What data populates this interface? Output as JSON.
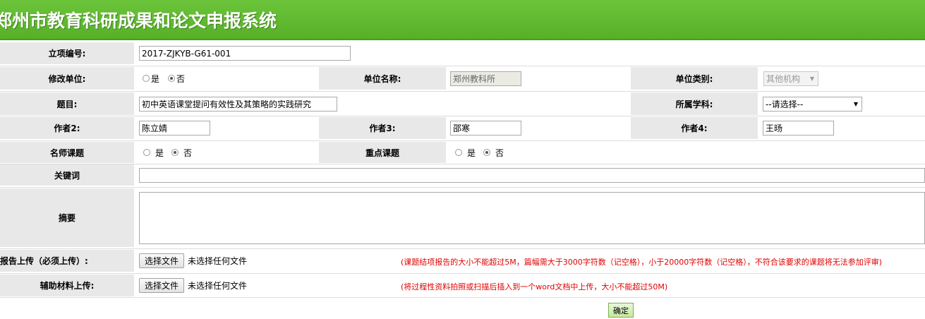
{
  "header": {
    "title": "郑州市教育科研成果和论文申报系统"
  },
  "form": {
    "project_no_label": "立项编号:",
    "project_no_value": "2017-ZJKYB-G61-001",
    "modify_unit_label": "修改单位:",
    "modify_unit_options": [
      "是",
      "否"
    ],
    "modify_unit_selected": "否",
    "unit_name_label": "单位名称:",
    "unit_name_value": "郑州教科所",
    "unit_type_label": "单位类别:",
    "unit_type_value": "其他机构",
    "topic_label": "题目:",
    "topic_value": "初中英语课堂提问有效性及其策略的实践研究",
    "subject_label": "所属学科:",
    "subject_value": "--请选择--",
    "author2_label": "作者2:",
    "author2_value": "陈立婧",
    "author3_label": "作者3:",
    "author3_value": "邵寒",
    "author4_label": "作者4:",
    "author4_value": "王旸",
    "famous_teacher_label": "名师课题",
    "famous_teacher_options": [
      "是",
      "否"
    ],
    "famous_teacher_selected": "否",
    "key_project_label": "重点课题",
    "key_project_options": [
      "是",
      "否"
    ],
    "key_project_selected": "否",
    "keywords_label": "关键词",
    "keywords_value": "",
    "abstract_label": "摘要",
    "abstract_value": "",
    "report_upload_label": "报告上传（必须上传）:",
    "report_upload_button": "选择文件",
    "report_upload_status": "未选择任何文件",
    "report_upload_note": "(课题结项报告的大小不能超过5M，篇幅需大于3000字符数（记空格），小于20000字符数（记空格），不符合该要求的课题将无法参加评审)",
    "aux_upload_label": "辅助材料上传:",
    "aux_upload_button": "选择文件",
    "aux_upload_status": "未选择任何文件",
    "aux_upload_note": "(将过程性资料拍照或扫描后插入到一个word文档中上传，大小不能超过50M)",
    "submit_label": "确定"
  },
  "colors": {
    "header_green": "#6cc43a",
    "label_bg": "#e8e8e8",
    "note_red": "#e00000"
  },
  "icons": {
    "dropdown": "chevron-down-icon"
  }
}
